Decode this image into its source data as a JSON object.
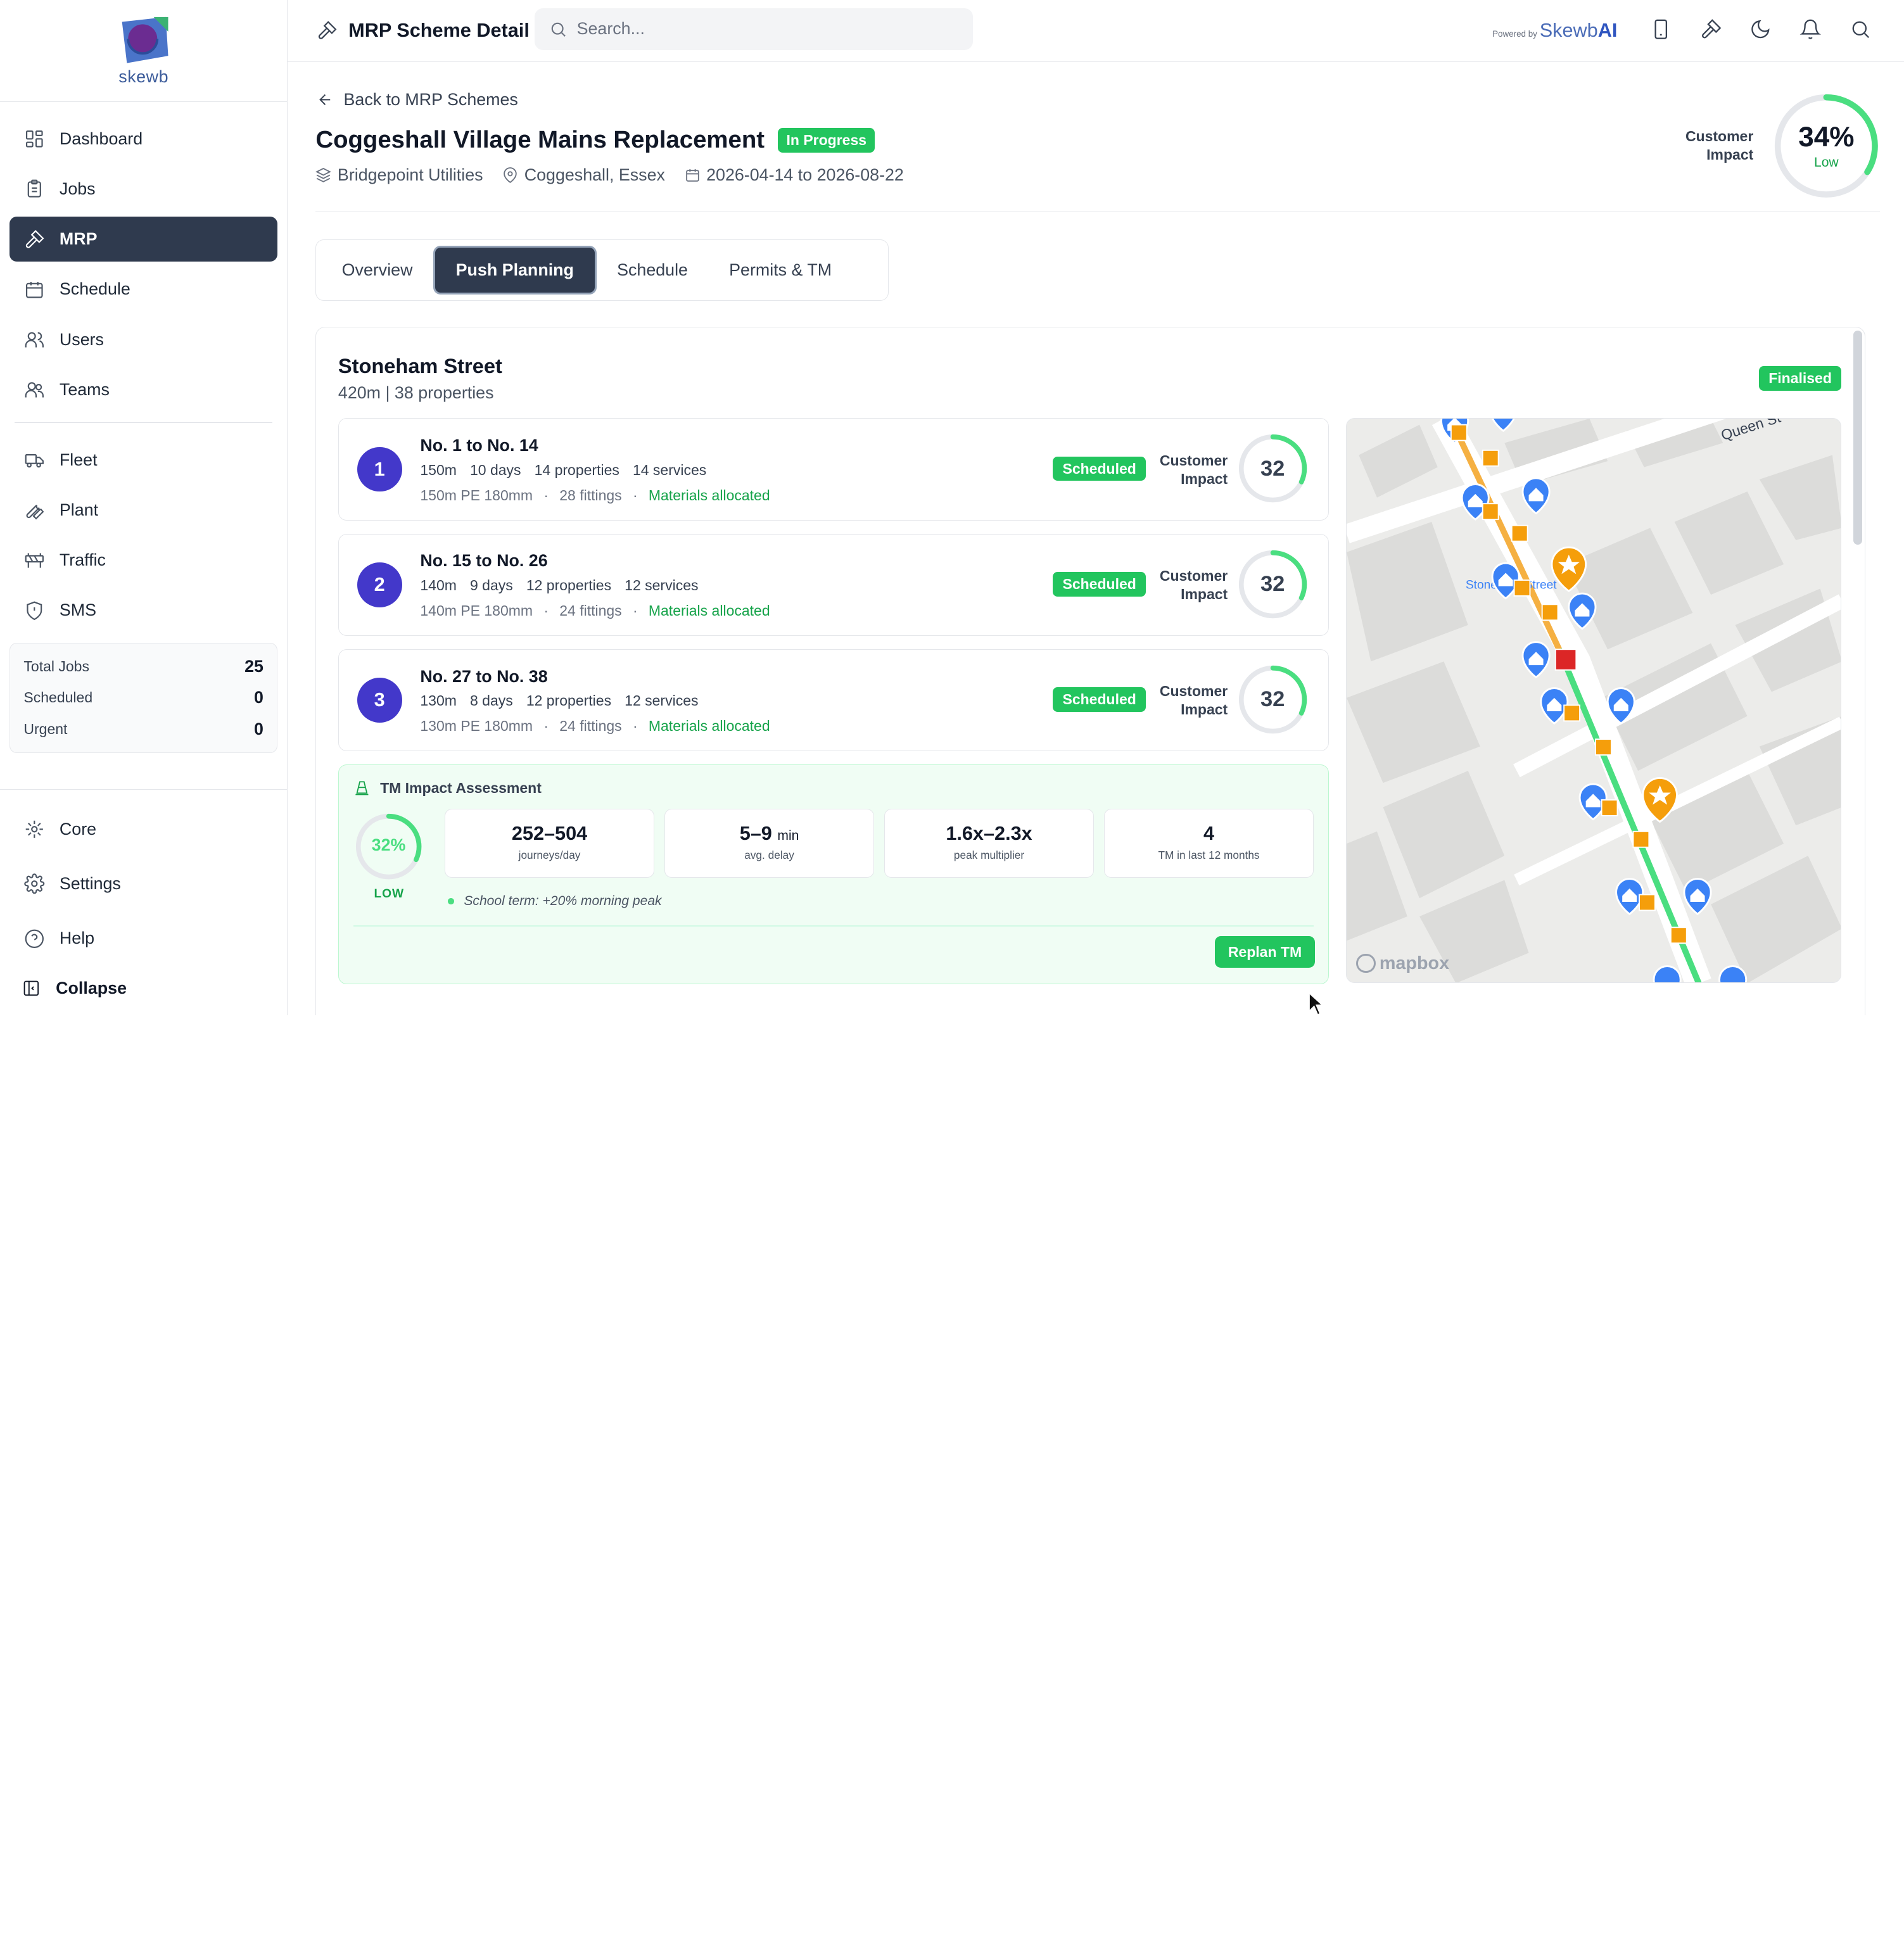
{
  "brand": {
    "name": "skewb",
    "powered_small": "Powered by",
    "powered_brand": "Skewb",
    "powered_ai": "AI"
  },
  "sidebar": {
    "items": [
      {
        "label": "Dashboard",
        "icon": "dashboard-icon"
      },
      {
        "label": "Jobs",
        "icon": "clipboard-icon"
      },
      {
        "label": "MRP",
        "icon": "hammer-icon",
        "active": true
      },
      {
        "label": "Schedule",
        "icon": "calendar-icon"
      },
      {
        "label": "Users",
        "icon": "users-icon"
      },
      {
        "label": "Teams",
        "icon": "teams-icon"
      }
    ],
    "items2": [
      {
        "label": "Fleet",
        "icon": "truck-icon"
      },
      {
        "label": "Plant",
        "icon": "wrench-icon"
      },
      {
        "label": "Traffic",
        "icon": "barrier-icon"
      },
      {
        "label": "SMS",
        "icon": "shield-icon"
      }
    ],
    "stats": [
      {
        "label": "Total Jobs",
        "value": "25"
      },
      {
        "label": "Scheduled",
        "value": "0"
      },
      {
        "label": "Urgent",
        "value": "0"
      }
    ],
    "bottom": [
      {
        "label": "Core",
        "icon": "core-icon"
      },
      {
        "label": "Settings",
        "icon": "gear-icon"
      },
      {
        "label": "Help",
        "icon": "help-icon"
      }
    ],
    "collapse_label": "Collapse"
  },
  "topbar": {
    "title": "MRP Scheme Detail",
    "search_placeholder": "Search..."
  },
  "page": {
    "back_label": "Back to MRP Schemes",
    "title": "Coggeshall Village Mains Replacement",
    "status": "In Progress",
    "client": "Bridgepoint Utilities",
    "location": "Coggeshall, Essex",
    "dates": "2026-04-14 to 2026-08-22",
    "customer_impact_label": "Customer Impact",
    "customer_impact_value": "34%",
    "customer_impact_percent": 34,
    "customer_impact_level": "Low"
  },
  "tabs": [
    {
      "label": "Overview"
    },
    {
      "label": "Push Planning",
      "active": true
    },
    {
      "label": "Schedule"
    },
    {
      "label": "Permits & TM"
    }
  ],
  "street": {
    "name": "Stoneham Street",
    "summary": "420m | 38 properties",
    "status": "Finalised"
  },
  "pushes": [
    {
      "num": "1",
      "title": "No. 1 to No. 14",
      "length": "150m",
      "days": "10 days",
      "properties": "14 properties",
      "services": "14 services",
      "pipe": "150m PE 180mm",
      "fittings": "28 fittings",
      "materials": "Materials allocated",
      "status": "Scheduled",
      "ci_label": "Customer Impact",
      "ci_value": "32"
    },
    {
      "num": "2",
      "title": "No. 15 to No. 26",
      "length": "140m",
      "days": "9 days",
      "properties": "12 properties",
      "services": "12 services",
      "pipe": "140m PE 180mm",
      "fittings": "24 fittings",
      "materials": "Materials allocated",
      "status": "Scheduled",
      "ci_label": "Customer Impact",
      "ci_value": "32"
    },
    {
      "num": "3",
      "title": "No. 27 to No. 38",
      "length": "130m",
      "days": "8 days",
      "properties": "12 properties",
      "services": "12 services",
      "pipe": "130m PE 180mm",
      "fittings": "24 fittings",
      "materials": "Materials allocated",
      "status": "Scheduled",
      "ci_label": "Customer Impact",
      "ci_value": "32"
    }
  ],
  "tm": {
    "title": "TM Impact Assessment",
    "gauge_value": "32%",
    "gauge_level": "LOW",
    "cards": [
      {
        "value": "252–504",
        "unit": "",
        "label": "journeys/day"
      },
      {
        "value": "5–9",
        "unit": "min",
        "label": "avg. delay"
      },
      {
        "value": "1.6x–2.3x",
        "unit": "",
        "label": "peak multiplier"
      },
      {
        "value": "4",
        "unit": "",
        "label": "TM in last 12 months"
      }
    ],
    "note": "School term: +20% morning peak",
    "replan_label": "Replan TM"
  },
  "map": {
    "street_label": "Stoneham Street",
    "queen_label": "Queen St",
    "attribution": "mapbox"
  },
  "colors": {
    "accent": "#2f3a4e",
    "success": "#22c55e",
    "push_num": "#4338ca",
    "pin": "#3b82f6",
    "fitting": "#f59e0b"
  }
}
